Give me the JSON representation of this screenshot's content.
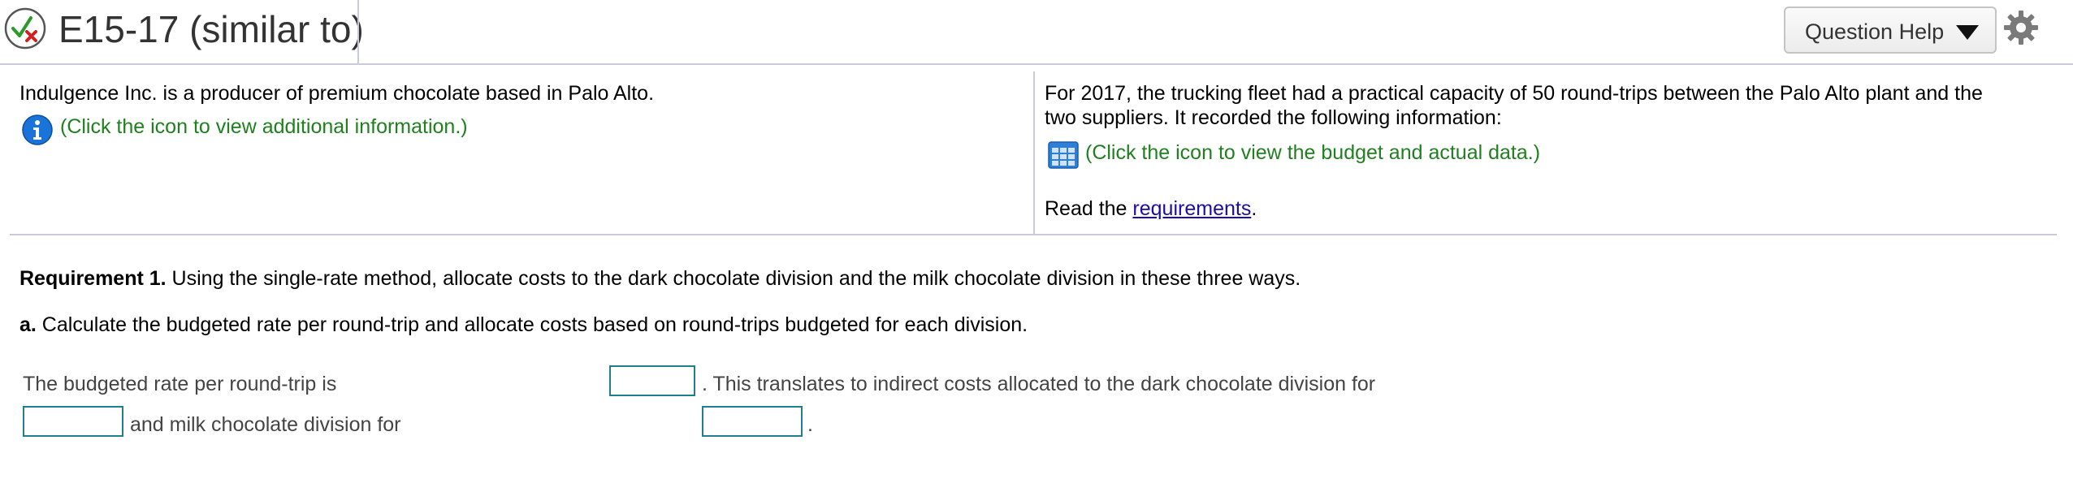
{
  "header": {
    "title": "E15-17 (similar to)",
    "help_label": "Question Help"
  },
  "left_panel": {
    "intro": "Indulgence Inc. is a producer of premium chocolate based in Palo Alto.",
    "info_link": "(Click the icon to view additional information.)"
  },
  "right_panel": {
    "line1": "For 2017, the trucking fleet had a practical capacity of 50 round-trips between the Palo Alto plant and the",
    "line2": "two suppliers. It recorded the following information:",
    "data_link": "(Click the icon to view the budget and actual data.)",
    "read_prefix": "Read the ",
    "requirements_link": "requirements",
    "read_suffix": "."
  },
  "requirement": {
    "label": "Requirement 1.",
    "text": " Using the single-rate method, allocate costs to the dark chocolate division and the milk chocolate division in these three ways.",
    "part_label": "a.",
    "part_text": " Calculate the budgeted rate per round-trip and allocate costs based on round-trips budgeted for each division."
  },
  "answer": {
    "rate_label": "The budgeted rate per round-trip is",
    "rate_value": "",
    "translate_text": ". This translates to indirect costs allocated to the dark chocolate division for",
    "dark_value": "",
    "milk_label": "and milk chocolate division for",
    "milk_value": "",
    "end_period": "."
  },
  "colors": {
    "link_green": "#208020",
    "link_blue": "#1a0dab",
    "input_border": "#1f7f8f",
    "info_blue": "#1a73d9"
  }
}
